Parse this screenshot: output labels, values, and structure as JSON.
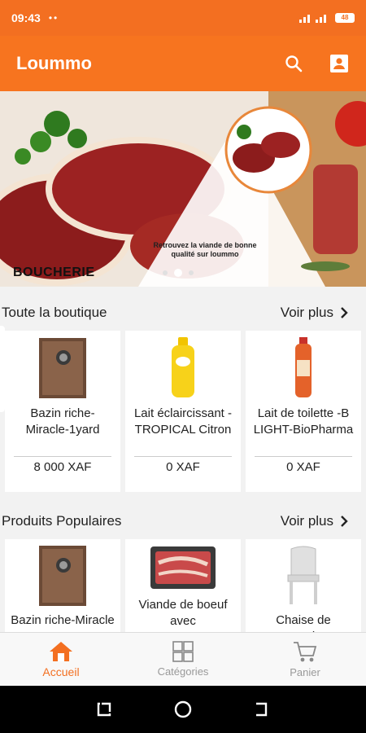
{
  "status": {
    "time": "09:43",
    "dots": "••",
    "battery": "48"
  },
  "app": {
    "title": "Loummo"
  },
  "banner": {
    "title": "BOUCHERIE",
    "caption": "Retrouvez la viande de bonne qualité sur loummo",
    "dot_count": 3,
    "active_dot": 2
  },
  "sections": [
    {
      "title": "Toute la boutique",
      "see_more": "Voir plus",
      "products": [
        {
          "name": "Bazin riche-Miracle-1yard",
          "price": "8 000 XAF",
          "image": "fabric-swatch"
        },
        {
          "name": "Lait éclaircissant -TROPICAL Citron",
          "price": "0 XAF",
          "image": "yellow-lotion-bottle"
        },
        {
          "name": "Lait de toilette -B LIGHT-BioPharma",
          "price": "0 XAF",
          "image": "orange-lotion-bottle"
        }
      ]
    },
    {
      "title": "Produits Populaires",
      "see_more": "Voir plus",
      "products": [
        {
          "name": "Bazin riche-Miracle",
          "price": "",
          "image": "fabric-swatch"
        },
        {
          "name": "Viande de boeuf avec",
          "price": "",
          "image": "beef-pack"
        },
        {
          "name": "Chaise de reception",
          "price": "",
          "image": "white-chair"
        }
      ]
    }
  ],
  "nav": {
    "items": [
      {
        "label": "Accueil",
        "icon": "home-icon",
        "active": true
      },
      {
        "label": "Catégories",
        "icon": "grid-icon",
        "active": false
      },
      {
        "label": "Panier",
        "icon": "cart-icon",
        "active": false
      }
    ]
  },
  "colors": {
    "brand": "#f7741f",
    "statusbar": "#f36f21",
    "active": "#f36f21",
    "inactive": "#999999"
  }
}
